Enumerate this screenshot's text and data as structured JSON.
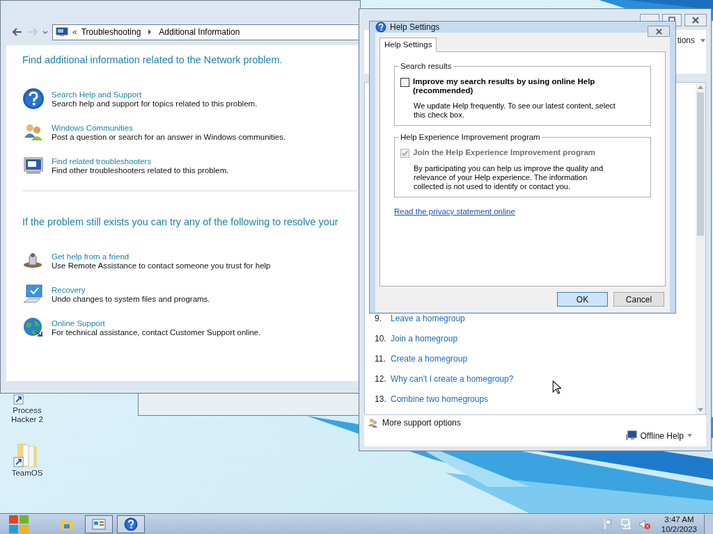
{
  "desktop": {
    "icons": [
      {
        "kind": "app",
        "label": "Process Hacker 2"
      },
      {
        "kind": "folder",
        "label": "TeamOS"
      }
    ]
  },
  "troubleshooter": {
    "address_overflow": "«",
    "breadcrumb": [
      "Troubleshooting",
      "Additional Information"
    ],
    "sections": [
      {
        "heading": "Find additional information related to the Network problem.",
        "items": [
          {
            "kind": "help",
            "title": "Search Help and Support",
            "description": "Search help and support for topics related to this problem."
          },
          {
            "kind": "community",
            "title": "Windows Communities",
            "description": "Post a question or search for an answer in Windows communities."
          },
          {
            "kind": "troubleshooter",
            "title": "Find related troubleshooters",
            "description": "Find other troubleshooters related to this problem."
          }
        ]
      },
      {
        "heading": "If the problem still exists you can try any of the following to resolve your",
        "items": [
          {
            "kind": "friend",
            "title": "Get help from a friend",
            "description": "Use Remote Assistance to contact someone you trust for help"
          },
          {
            "kind": "recovery",
            "title": "Recovery",
            "description": "Undo changes to system files and programs."
          },
          {
            "kind": "online",
            "title": "Online Support",
            "description": "For technical assistance, contact Customer Support online."
          }
        ]
      }
    ]
  },
  "help_window": {
    "options_label": "tions",
    "topics": [
      {
        "number": "9.",
        "title": "Leave a homegroup"
      },
      {
        "number": "10.",
        "title": "Join a homegroup"
      },
      {
        "number": "11.",
        "title": "Create a homegroup"
      },
      {
        "number": "12.",
        "title": "Why can't I create a homegroup?"
      },
      {
        "number": "13.",
        "title": "Combine two homegroups"
      }
    ],
    "more_support": "More support options",
    "offline_help": "Offline Help"
  },
  "dialog": {
    "title": "Help Settings",
    "tabs": [
      {
        "label": "Help Settings",
        "selected": true
      }
    ],
    "groups": [
      {
        "legend": "Search results",
        "option": {
          "label": "Improve my search results by using online Help (recommended)",
          "checked": false,
          "disabled": false
        },
        "note": "We update Help frequently. To see our latest content, select this check box."
      },
      {
        "legend": "Help Experience Improvement program",
        "option": {
          "label": "Join the Help Experience Improvement program",
          "checked": true,
          "disabled": true
        },
        "note": "By participating you can help us improve the quality and relevance of your Help experience. The information collected is not used to identify or contact you."
      }
    ],
    "link": "Read the privacy statement online",
    "buttons": [
      {
        "label": "OK",
        "default": true
      },
      {
        "label": "Cancel",
        "default": false
      }
    ]
  },
  "taskbar": {
    "apps": [
      {
        "kind": "explorer",
        "open": false
      },
      {
        "kind": "control-panel",
        "open": true
      },
      {
        "kind": "help",
        "open": true
      }
    ],
    "tray": {
      "volume_muted": true,
      "time": "3:47 AM",
      "date": "10/2/2023"
    }
  }
}
